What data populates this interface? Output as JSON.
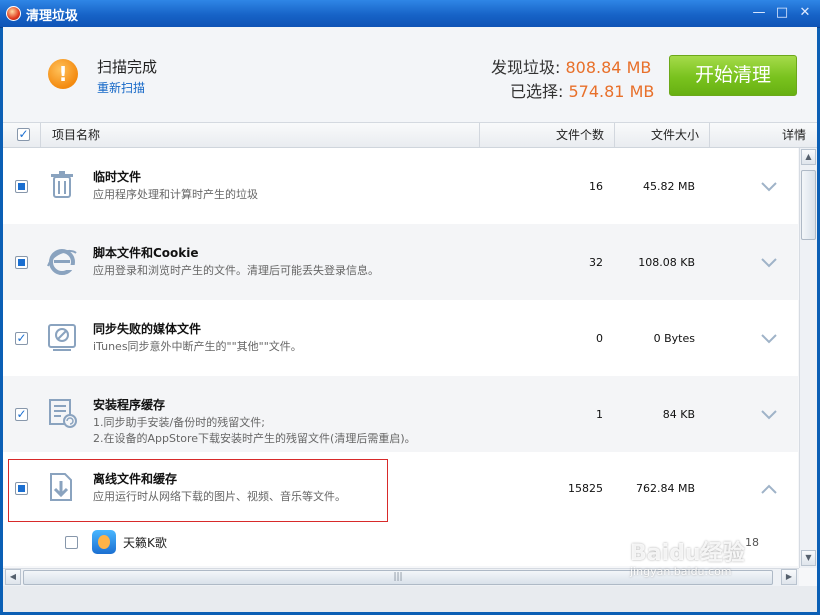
{
  "window": {
    "title": "清理垃圾",
    "controls": [
      "—",
      "□",
      "✕"
    ]
  },
  "header": {
    "status": "扫描完成",
    "rescan": "重新扫描",
    "found_label": "发现垃圾:",
    "found_value": "808.84 MB",
    "selected_label": "已选择:",
    "selected_value": "574.81 MB",
    "clean_button": "开始清理"
  },
  "columns": {
    "name": "项目名称",
    "count": "文件个数",
    "size": "文件大小",
    "detail": "详情"
  },
  "rows": [
    {
      "title": "临时文件",
      "desc": "应用程序处理和计算时产生的垃圾",
      "desc2": "",
      "count": "16",
      "size": "45.82 MB",
      "icon": "trash-icon",
      "check": "square"
    },
    {
      "title": "脚本文件和Cookie",
      "desc": "应用登录和浏览时产生的文件。清理后可能丢失登录信息。",
      "desc2": "",
      "count": "32",
      "size": "108.08 KB",
      "icon": "ie-icon",
      "check": "square"
    },
    {
      "title": "同步失败的媒体文件",
      "desc": "iTunes同步意外中断产生的\"\"其他\"\"文件。",
      "desc2": "",
      "count": "0",
      "size": "0 Bytes",
      "icon": "media-icon",
      "check": "tick"
    },
    {
      "title": "安装程序缓存",
      "desc": "1.同步助手安装/备份时的残留文件;",
      "desc2": "2.在设备的AppStore下载安装时产生的残留文件(清理后需重启)。",
      "count": "1",
      "size": "84 KB",
      "icon": "installer-cache-icon",
      "check": "tick"
    },
    {
      "title": "离线文件和缓存",
      "desc": "应用运行时从网络下载的图片、视频、音乐等文件。",
      "desc2": "",
      "count": "15825",
      "size": "762.84 MB",
      "icon": "download-icon",
      "check": "square"
    }
  ],
  "subitem": {
    "name": "天籁K歌",
    "count": "18"
  },
  "watermark": {
    "brand": "Baidu经验",
    "url": "jingyan.baidu.com"
  }
}
